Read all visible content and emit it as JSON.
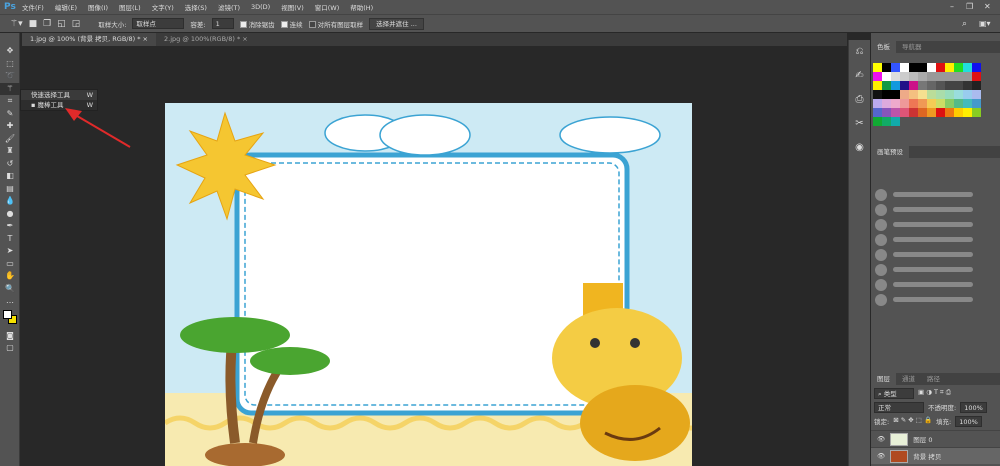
{
  "app": {
    "logo": "Ps",
    "menu": [
      "文件(F)",
      "编辑(E)",
      "图像(I)",
      "图层(L)",
      "文字(Y)",
      "选择(S)",
      "滤镜(T)",
      "3D(D)",
      "视图(V)",
      "窗口(W)",
      "帮助(H)"
    ],
    "window": {
      "minimize": "–",
      "restore": "❐",
      "close": "✕"
    }
  },
  "options": {
    "sample_size_label": "取样大小:",
    "sample_size_value": "取样点",
    "tolerance_label": "容差:",
    "tolerance_value": "1",
    "anti_alias": "消除锯齿",
    "contiguous": "连续",
    "all_layers": "对所有图层取样",
    "select_mask": "选择并遮住 ..."
  },
  "tabs": [
    {
      "label": "1.jpg @ 100% (背景 拷贝, RGB/8) *",
      "close": "×"
    },
    {
      "label": "2.jpg @ 100%(RGB/8) *",
      "close": "×"
    }
  ],
  "flyout": [
    {
      "label": "快速选择工具",
      "key": "W"
    },
    {
      "label": "魔棒工具",
      "key": "W"
    }
  ],
  "panels": {
    "swatches_tabs": [
      "色板",
      "导航器"
    ],
    "brush_presets": "画笔预设",
    "layers_tabs": [
      "图层",
      "通道",
      "路径"
    ],
    "filter_kind": "类型",
    "blend_mode": "正常",
    "opacity_label": "不透明度:",
    "opacity_value": "100%",
    "lock_label": "锁定:",
    "fill_label": "填充:",
    "fill_value": "100%",
    "layers": [
      {
        "name": "图层 0"
      },
      {
        "name": "背景 拷贝"
      }
    ]
  },
  "swatch_colors": [
    "#ffff00",
    "#000000",
    "#3355ff",
    "#ffffff",
    "#000000",
    "#000000",
    "#ffffff",
    "#e01010",
    "#ffee00",
    "#22dd22",
    "#22dddd",
    "#1010ee",
    "#ee10ee",
    "#ffffff",
    "#dddddd",
    "#cccccc",
    "#bbbbbb",
    "#aaaaaa",
    "#999999",
    "#999999",
    "#999999",
    "#999999",
    "#999999",
    "#e01010",
    "#ffee00",
    "#119944",
    "#1199dd",
    "#221188",
    "#cc1188",
    "#777777",
    "#666666",
    "#555555",
    "#444444",
    "#444444",
    "#333333",
    "#222222",
    "#111111",
    "#000000",
    "#000000",
    "#eeaa88",
    "#f4c080",
    "#f6e090",
    "#bbdd99",
    "#aaddaa",
    "#99ddbb",
    "#99dddd",
    "#99ccee",
    "#aabbee",
    "#bbaaee",
    "#ddaadd",
    "#eeaacc",
    "#ee9999",
    "#ee7755",
    "#f09955",
    "#f4cc55",
    "#ccdd66",
    "#88cc66",
    "#55bb88",
    "#44bbbb",
    "#4499cc",
    "#5566cc",
    "#8855bb",
    "#bb55aa",
    "#dd5577",
    "#cc3333",
    "#dd6622",
    "#ee9922",
    "#dd1111",
    "#ee7711",
    "#ffcc00",
    "#ffee00",
    "#88cc22",
    "#11aa33",
    "#11aa66",
    "#11aaaa"
  ]
}
